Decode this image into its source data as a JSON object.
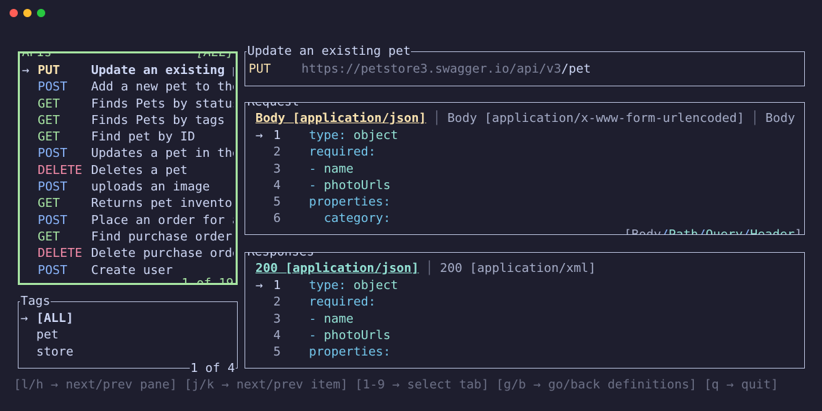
{
  "window": {
    "dots": [
      "#ff5f57",
      "#febc2e",
      "#28c840"
    ]
  },
  "colors": {
    "put": "#f9e2af",
    "post": "#89b4fa",
    "get": "#a6e3a1",
    "delete": "#f38ba8",
    "yaml_key": "#74c7ec",
    "yaml_value": "#94e2d5",
    "active_border": "#a6e3a1"
  },
  "apis": {
    "title": "APIs",
    "filter": "[ALL]",
    "pagination": "1 of 19",
    "items": [
      {
        "arrow": "→",
        "method": "PUT",
        "summary": "Update an existing pet",
        "selected": true
      },
      {
        "arrow": "",
        "method": "POST",
        "summary": "Add a new pet to the store"
      },
      {
        "arrow": "",
        "method": "GET",
        "summary": "Finds Pets by status"
      },
      {
        "arrow": "",
        "method": "GET",
        "summary": "Finds Pets by tags"
      },
      {
        "arrow": "",
        "method": "GET",
        "summary": "Find pet by ID"
      },
      {
        "arrow": "",
        "method": "POST",
        "summary": "Updates a pet in the store"
      },
      {
        "arrow": "",
        "method": "DELETE",
        "summary": "Deletes a pet"
      },
      {
        "arrow": "",
        "method": "POST",
        "summary": "uploads an image"
      },
      {
        "arrow": "",
        "method": "GET",
        "summary": "Returns pet inventories"
      },
      {
        "arrow": "",
        "method": "POST",
        "summary": "Place an order for a pet"
      },
      {
        "arrow": "",
        "method": "GET",
        "summary": "Find purchase order by ID"
      },
      {
        "arrow": "",
        "method": "DELETE",
        "summary": "Delete purchase order by ID"
      },
      {
        "arrow": "",
        "method": "POST",
        "summary": "Create user"
      }
    ]
  },
  "tags": {
    "title": "Tags",
    "pagination": "1 of 4",
    "items": [
      {
        "arrow": "→",
        "label": "[ALL]",
        "selected": true
      },
      {
        "arrow": "",
        "label": "pet"
      },
      {
        "arrow": "",
        "label": "store"
      }
    ]
  },
  "endpoint": {
    "title": "Update an existing pet",
    "method": "PUT",
    "base_url": "https://petstore3.swagger.io/api/v3",
    "path": "/pet"
  },
  "request": {
    "title": "Request",
    "tabs": [
      {
        "label": "Body [application/json]",
        "active": true
      },
      {
        "label": "Body [application/x-www-form-urlencoded]"
      },
      {
        "label": "Body [application/xml]"
      }
    ],
    "lines": [
      {
        "arrow": "→",
        "num": "1",
        "indent": "",
        "dash": "",
        "key": "type",
        "colon": ":",
        "value": " object"
      },
      {
        "arrow": "",
        "num": "2",
        "indent": "",
        "dash": "",
        "key": "required",
        "colon": ":",
        "value": ""
      },
      {
        "arrow": "",
        "num": "3",
        "indent": "",
        "dash": "- ",
        "key": "",
        "colon": "",
        "value": "name"
      },
      {
        "arrow": "",
        "num": "4",
        "indent": "",
        "dash": "- ",
        "key": "",
        "colon": "",
        "value": "photoUrls"
      },
      {
        "arrow": "",
        "num": "5",
        "indent": "",
        "dash": "",
        "key": "properties",
        "colon": ":",
        "value": ""
      },
      {
        "arrow": "",
        "num": "6",
        "indent": "  ",
        "dash": "",
        "key": "category",
        "colon": ":",
        "value": ""
      }
    ],
    "footer": {
      "open": "[",
      "items": [
        "Body",
        "Path",
        "Query",
        "Header"
      ],
      "separator": "/",
      "close": "]"
    }
  },
  "responses": {
    "title": "Responses",
    "tabs": [
      {
        "label": "200 [application/json]",
        "active": true
      },
      {
        "label": "200 [application/xml]"
      }
    ],
    "lines": [
      {
        "arrow": "→",
        "num": "1",
        "indent": "",
        "dash": "",
        "key": "type",
        "colon": ":",
        "value": " object"
      },
      {
        "arrow": "",
        "num": "2",
        "indent": "",
        "dash": "",
        "key": "required",
        "colon": ":",
        "value": ""
      },
      {
        "arrow": "",
        "num": "3",
        "indent": "",
        "dash": "- ",
        "key": "",
        "colon": "",
        "value": "name"
      },
      {
        "arrow": "",
        "num": "4",
        "indent": "",
        "dash": "- ",
        "key": "",
        "colon": "",
        "value": "photoUrls"
      },
      {
        "arrow": "",
        "num": "5",
        "indent": "",
        "dash": "",
        "key": "properties",
        "colon": ":",
        "value": ""
      }
    ]
  },
  "help": "[l/h → next/prev pane] [j/k → next/prev item] [1-9 → select tab] [g/b → go/back definitions] [q → quit]"
}
